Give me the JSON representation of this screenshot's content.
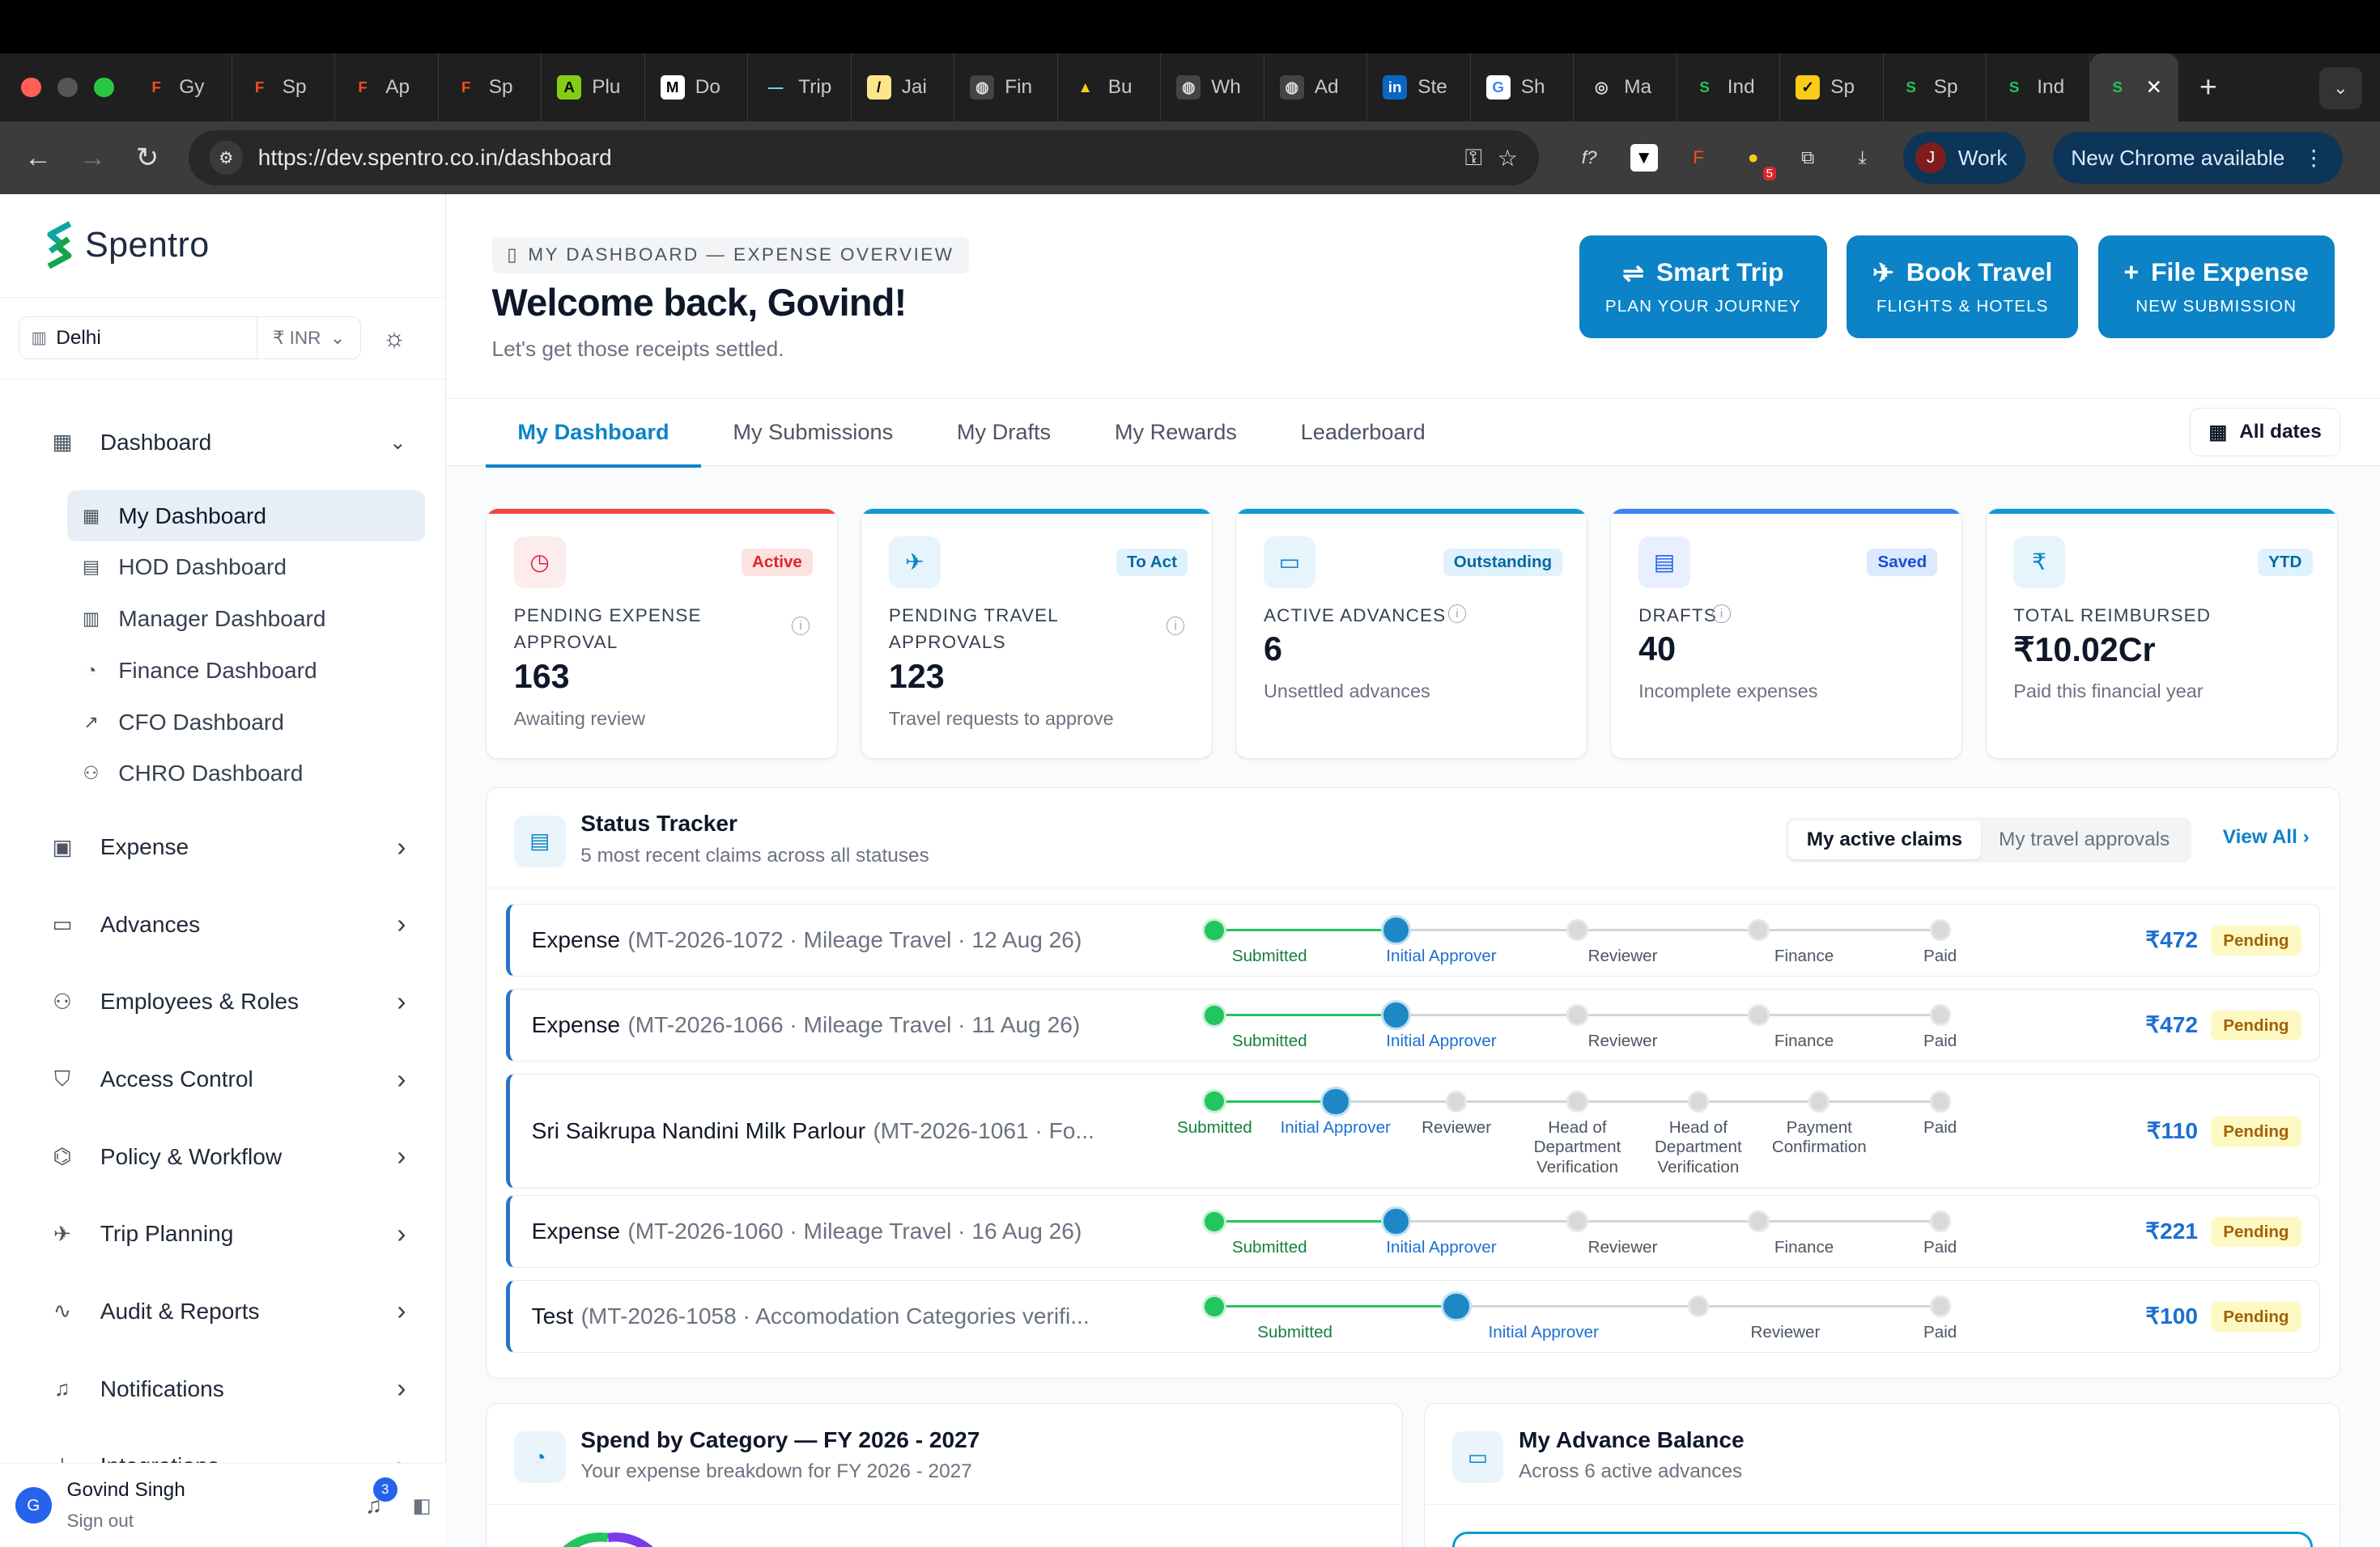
{
  "browser": {
    "tabs": [
      {
        "label": "Gy",
        "fav_bg": "#1f1f1f",
        "fav_color": "#f24e1e",
        "glyph": "F"
      },
      {
        "label": "Sp",
        "fav_bg": "#1f1f1f",
        "fav_color": "#f24e1e",
        "glyph": "F"
      },
      {
        "label": "Ap",
        "fav_bg": "#1f1f1f",
        "fav_color": "#f24e1e",
        "glyph": "F"
      },
      {
        "label": "Sp",
        "fav_bg": "#1f1f1f",
        "fav_color": "#f24e1e",
        "glyph": "F"
      },
      {
        "label": "Plu",
        "fav_bg": "#84cc16",
        "fav_color": "#000",
        "glyph": "A"
      },
      {
        "label": "Do",
        "fav_bg": "#fff",
        "fav_color": "#000",
        "glyph": "M"
      },
      {
        "label": "Trip",
        "fav_bg": "#1f1f1f",
        "fav_color": "#7dd3fc",
        "glyph": "—"
      },
      {
        "label": "Jai",
        "fav_bg": "#fde68a",
        "fav_color": "#000",
        "glyph": "/"
      },
      {
        "label": "Fin",
        "fav_bg": "#444",
        "fav_color": "#ddd",
        "glyph": "◍"
      },
      {
        "label": "Bu",
        "fav_bg": "#1f1f1f",
        "fav_color": "#facc15",
        "glyph": "▲"
      },
      {
        "label": "Wh",
        "fav_bg": "#444",
        "fav_color": "#ddd",
        "glyph": "◍"
      },
      {
        "label": "Ad",
        "fav_bg": "#444",
        "fav_color": "#ddd",
        "glyph": "◍"
      },
      {
        "label": "Ste",
        "fav_bg": "#0a66c2",
        "fav_color": "#fff",
        "glyph": "in"
      },
      {
        "label": "Sh",
        "fav_bg": "#fff",
        "fav_color": "#4285f4",
        "glyph": "G"
      },
      {
        "label": "Ma",
        "fav_bg": "#1f1f1f",
        "fav_color": "#ddd",
        "glyph": "◎"
      },
      {
        "label": "Ind",
        "fav_bg": "#1f1f1f",
        "fav_color": "#22c55e",
        "glyph": "S"
      },
      {
        "label": "Sp",
        "fav_bg": "#facc15",
        "fav_color": "#000",
        "glyph": "✓"
      },
      {
        "label": "Sp",
        "fav_bg": "#1f1f1f",
        "fav_color": "#22c55e",
        "glyph": "S"
      },
      {
        "label": "Ind",
        "fav_bg": "#1f1f1f",
        "fav_color": "#22c55e",
        "glyph": "S"
      }
    ],
    "active_tab_glyph": "S",
    "new_tab": "+",
    "url": "https://dev.spentro.co.in/dashboard",
    "profile_initial": "J",
    "profile_label": "Work",
    "update_label": "New Chrome available",
    "ext_badge": "5"
  },
  "sidebar": {
    "brand": "Spentro",
    "location": "Delhi",
    "currency": "₹ INR",
    "dashboard_label": "Dashboard",
    "dashboard_items": [
      {
        "label": "My Dashboard",
        "icon": "▦",
        "name": "my-dashboard"
      },
      {
        "label": "HOD Dashboard",
        "icon": "▤",
        "name": "hod-dashboard"
      },
      {
        "label": "Manager Dashboard",
        "icon": "▥",
        "name": "manager-dashboard"
      },
      {
        "label": "Finance Dashboard",
        "icon": "◔",
        "name": "finance-dashboard"
      },
      {
        "label": "CFO Dashboard",
        "icon": "↗",
        "name": "cfo-dashboard"
      },
      {
        "label": "CHRO Dashboard",
        "icon": "⚇",
        "name": "chro-dashboard"
      }
    ],
    "groups": [
      {
        "label": "Expense",
        "icon": "▣",
        "name": "expense"
      },
      {
        "label": "Advances",
        "icon": "▭",
        "name": "advances"
      },
      {
        "label": "Employees & Roles",
        "icon": "⚇",
        "name": "employees-roles"
      },
      {
        "label": "Access Control",
        "icon": "⛉",
        "name": "access-control"
      },
      {
        "label": "Policy & Workflow",
        "icon": "⌬",
        "name": "policy-workflow"
      },
      {
        "label": "Trip Planning",
        "icon": "✈",
        "name": "trip-planning"
      },
      {
        "label": "Audit & Reports",
        "icon": "∿",
        "name": "audit-reports"
      },
      {
        "label": "Notifications",
        "icon": "♫",
        "name": "notifications"
      },
      {
        "label": "Integrations",
        "icon": "⏚",
        "name": "integrations"
      }
    ],
    "user": {
      "initial": "G",
      "name": "Govind Singh",
      "signout": "Sign out",
      "notif_count": "3"
    }
  },
  "header": {
    "crumb": "MY DASHBOARD — EXPENSE OVERVIEW",
    "welcome": "Welcome back, Govind!",
    "tagline": "Let's get those receipts settled.",
    "actions": [
      {
        "title": "Smart Trip",
        "sub": "PLAN YOUR JOURNEY",
        "icon": "⇌"
      },
      {
        "title": "Book Travel",
        "sub": "FLIGHTS & HOTELS",
        "icon": "✈"
      },
      {
        "title": "File Expense",
        "sub": "NEW SUBMISSION",
        "icon": "+"
      }
    ]
  },
  "tabs": [
    "My Dashboard",
    "My Submissions",
    "My Drafts",
    "My Rewards",
    "Leaderboard"
  ],
  "dates_label": "All dates",
  "kpis": [
    {
      "badge": "Active",
      "label": "PENDING EXPENSE APPROVAL",
      "value": "163",
      "sub": "Awaiting review",
      "accent": "#ef4444",
      "icon": "◷",
      "ico_bg": "#fdecec",
      "ico_color": "#e11d48",
      "badge_bg": "#fde2e2",
      "badge_color": "#dc2626",
      "info": true
    },
    {
      "badge": "To Act",
      "label": "PENDING TRAVEL APPROVALS",
      "value": "123",
      "sub": "Travel requests to approve",
      "accent": "#0b9ad6",
      "icon": "✈",
      "ico_bg": "#e6f4fb",
      "ico_color": "#0b83c6",
      "badge_bg": "#e0f2fe",
      "badge_color": "#0369a1",
      "info": true
    },
    {
      "badge": "Outstanding",
      "label": "ACTIVE ADVANCES",
      "value": "6",
      "sub": "Unsettled advances",
      "accent": "#0b9ad6",
      "icon": "▭",
      "ico_bg": "#e6f4fb",
      "ico_color": "#0b83c6",
      "badge_bg": "#e0f2fe",
      "badge_color": "#0369a1",
      "info": true
    },
    {
      "badge": "Saved",
      "label": "DRAFTS",
      "value": "40",
      "sub": "Incomplete expenses",
      "accent": "#3b82f6",
      "icon": "▤",
      "ico_bg": "#e8efff",
      "ico_color": "#2563eb",
      "badge_bg": "#dbeafe",
      "badge_color": "#1d4ed8",
      "info": true
    },
    {
      "badge": "YTD",
      "label": "TOTAL REIMBURSED",
      "value": "₹10.02Cr",
      "sub": "Paid this financial year",
      "accent": "#0b9ad6",
      "icon": "₹",
      "ico_bg": "#e6f4fb",
      "ico_color": "#0b83c6",
      "badge_bg": "#e0f2fe",
      "badge_color": "#0369a1",
      "info": false
    }
  ],
  "tracker": {
    "title": "Status Tracker",
    "subtitle": "5 most recent claims across all statuses",
    "toggle": [
      "My active claims",
      "My travel approvals"
    ],
    "view_all": "View All",
    "rows": [
      {
        "title": "Expense",
        "meta": "(MT-2026-1072 · Mileage Travel · 12 Aug 26)",
        "amount": "₹472",
        "status": "Pending",
        "steps": [
          "Submitted",
          "Initial Approver",
          "Reviewer",
          "Finance",
          "Paid"
        ],
        "done": 1
      },
      {
        "title": "Expense",
        "meta": "(MT-2026-1066 · Mileage Travel · 11 Aug 26)",
        "amount": "₹472",
        "status": "Pending",
        "steps": [
          "Submitted",
          "Initial Approver",
          "Reviewer",
          "Finance",
          "Paid"
        ],
        "done": 1
      },
      {
        "title": "Sri Saikrupa Nandini Milk Parlour",
        "meta": "(MT-2026-1061 · Fo...",
        "amount": "₹110",
        "status": "Pending",
        "steps": [
          "Submitted",
          "Initial Approver",
          "Reviewer",
          "Head of Department Verification",
          "Head of Department Verification",
          "Payment Confirmation",
          "Paid"
        ],
        "done": 1
      },
      {
        "title": "Expense",
        "meta": "(MT-2026-1060 · Mileage Travel · 16 Aug 26)",
        "amount": "₹221",
        "status": "Pending",
        "steps": [
          "Submitted",
          "Initial Approver",
          "Reviewer",
          "Finance",
          "Paid"
        ],
        "done": 1
      },
      {
        "title": "Test",
        "meta": "(MT-2026-1058 · Accomodation Categories verifi...",
        "amount": "₹100",
        "status": "Pending",
        "steps": [
          "Submitted",
          "Initial Approver",
          "Reviewer",
          "Paid"
        ],
        "done": 1
      }
    ]
  },
  "spend": {
    "title": "Spend by Category — FY 2026 - 2027",
    "subtitle": "Your expense breakdown for FY 2026 - 2027"
  },
  "advance": {
    "title": "My Advance Balance",
    "subtitle": "Across 6 active advances"
  }
}
